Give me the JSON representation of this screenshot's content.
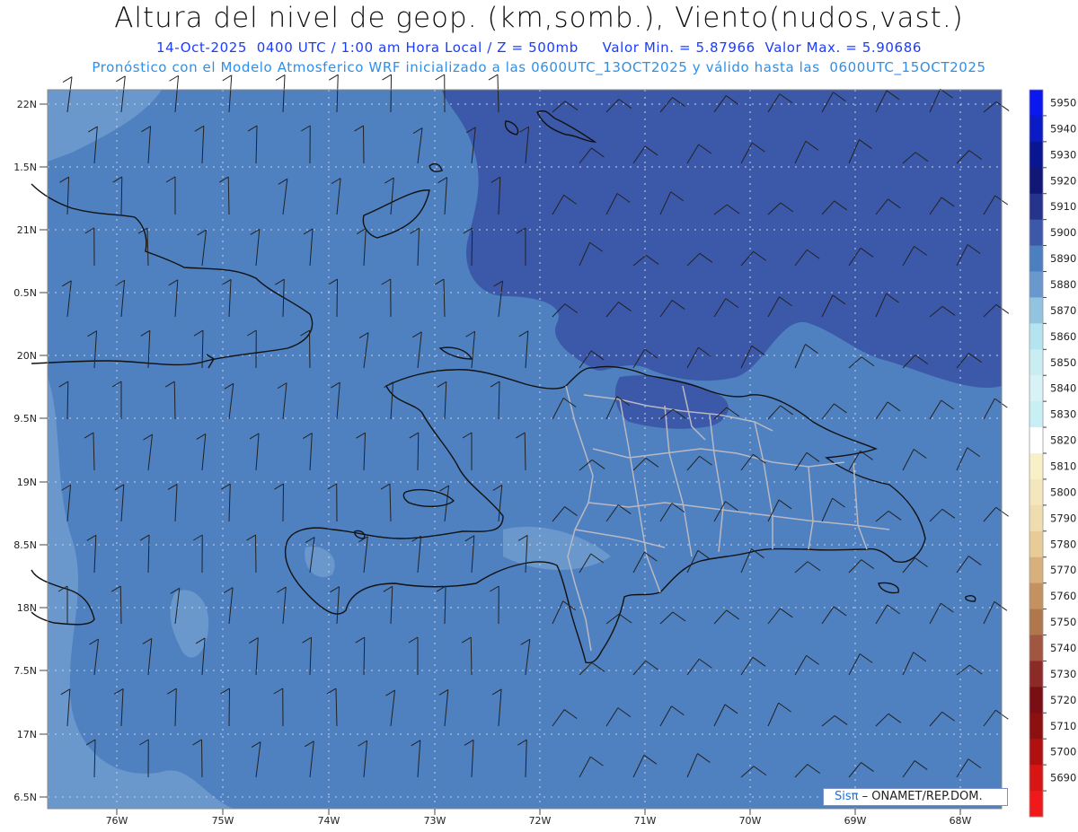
{
  "header": {
    "title": "Altura del nivel de geop. (km,somb.), Viento(nudos,vast.)",
    "subtitle_line1": "14-Oct-2025  0400 UTC / 1:00 am Hora Local / Z = 500mb     Valor Min. = 5.87966  Valor Max. = 5.90686",
    "subtitle_line2": "Pronóstico con el Modelo Atmosferico WRF inicializado a las 0600UTC_13OCT2025 y válido hasta las  0600UTC_15OCT2025"
  },
  "map": {
    "lat_labels": [
      "22N",
      "1.5N",
      "21N",
      "0.5N",
      "20N",
      "9.5N",
      "19N",
      "8.5N",
      "18N",
      "7.5N",
      "17N",
      "6.5N"
    ],
    "lon_labels": [
      "76W",
      "75W",
      "74W",
      "73W",
      "72W",
      "71W",
      "70W",
      "69W",
      "68W"
    ],
    "colors": {
      "lowest_area": "#6a98cc",
      "mid_area": "#4f80c0",
      "high_area": "#3c58a8",
      "coastline": "#111111",
      "provinces": "#b8b8c4",
      "grid": "#c8d4e6",
      "barbs": "#222222"
    }
  },
  "colorbar": {
    "ticks": [
      "5950",
      "5940",
      "5930",
      "5920",
      "5910",
      "5900",
      "5890",
      "5880",
      "5870",
      "5860",
      "5850",
      "5840",
      "5830",
      "5820",
      "5810",
      "5800",
      "5790",
      "5780",
      "5770",
      "5760",
      "5750",
      "5740",
      "5730",
      "5720",
      "5710",
      "5700",
      "5690"
    ],
    "colors": [
      "#0b17f0",
      "#0a1ac4",
      "#0a1591",
      "#101777",
      "#26338c",
      "#3d58a8",
      "#4c7fc0",
      "#6898ce",
      "#92c4e0",
      "#b4e4ef",
      "#c9edf3",
      "#d8f2f6",
      "#c8f0f4",
      "#ffffff",
      "#f8f0c6",
      "#f4e6bd",
      "#efddb0",
      "#e8cc98",
      "#d8b07c",
      "#c49160",
      "#b0764c",
      "#a05640",
      "#8c2a28",
      "#7a0e14",
      "#8c1010",
      "#b01010",
      "#d81414",
      "#f01818"
    ]
  },
  "credit": {
    "logo": "Sisπ",
    "text": " – ONAMET/REP.DOM."
  }
}
